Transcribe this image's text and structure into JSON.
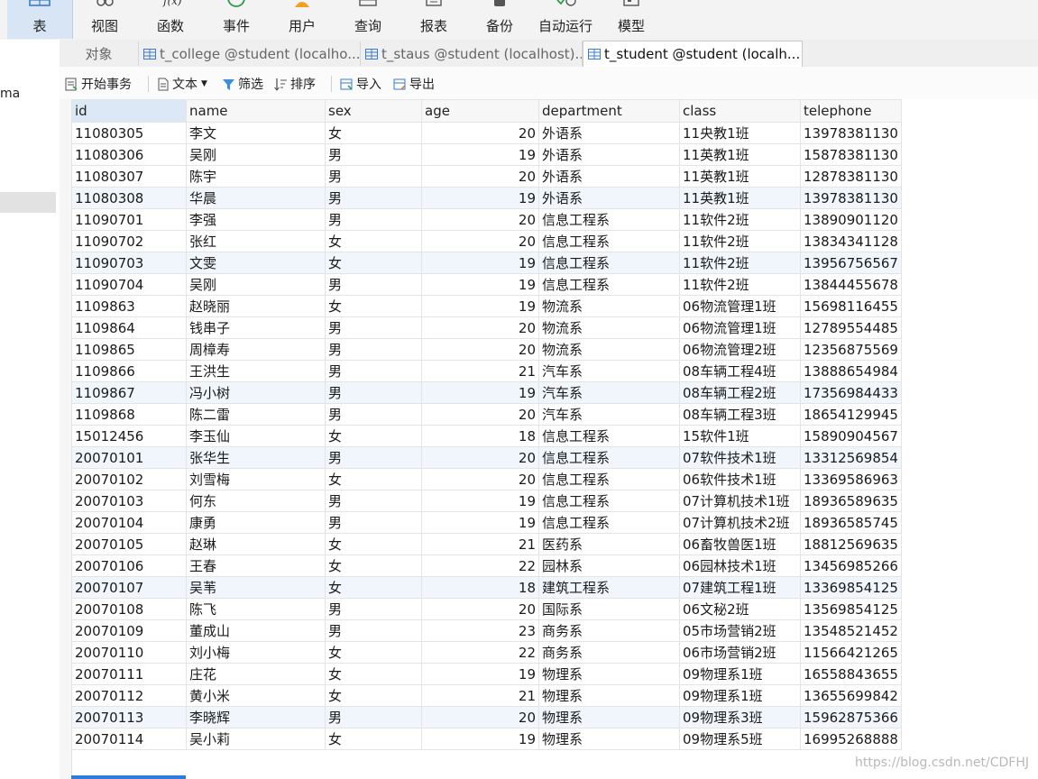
{
  "ribbon": {
    "items": [
      {
        "label": "表",
        "icon": "table-icon",
        "active": true
      },
      {
        "label": "视图",
        "icon": "view-icon"
      },
      {
        "label": "函数",
        "icon": "function-icon"
      },
      {
        "label": "事件",
        "icon": "event-clock-icon"
      },
      {
        "label": "用户",
        "icon": "user-icon"
      },
      {
        "label": "查询",
        "icon": "query-icon"
      },
      {
        "label": "报表",
        "icon": "report-icon"
      },
      {
        "label": "备份",
        "icon": "backup-icon"
      },
      {
        "label": "自动运行",
        "icon": "auto-run-icon"
      },
      {
        "label": "模型",
        "icon": "model-icon"
      }
    ]
  },
  "left_panel": {
    "schema_fragment": "ma"
  },
  "tabs": {
    "objects": "对象",
    "items": [
      {
        "label": "t_college @student (localho..."
      },
      {
        "label": "t_staus @student (localhost)..."
      },
      {
        "label": "t_student @student (localh...",
        "active": true
      }
    ]
  },
  "toolbar": {
    "begin_transaction": "开始事务",
    "text": "文本",
    "filter": "筛选",
    "sort": "排序",
    "import": "导入",
    "export": "导出"
  },
  "table": {
    "columns": [
      "id",
      "name",
      "sex",
      "age",
      "department",
      "class",
      "telephone"
    ],
    "rows": [
      [
        "11080305",
        "李文",
        "女",
        "20",
        "外语系",
        "11央教1班",
        "13978381130"
      ],
      [
        "11080306",
        "吴刚",
        "男",
        "19",
        "外语系",
        "11英教1班",
        "15878381130"
      ],
      [
        "11080307",
        "陈宇",
        "男",
        "20",
        "外语系",
        "11英教1班",
        "12878381130"
      ],
      [
        "11080308",
        "华晨",
        "男",
        "19",
        "外语系",
        "11英教1班",
        "13978381130"
      ],
      [
        "11090701",
        "李强",
        "男",
        "20",
        "信息工程系",
        "11软件2班",
        "13890901120"
      ],
      [
        "11090702",
        "张红",
        "女",
        "20",
        "信息工程系",
        "11软件2班",
        "13834341128"
      ],
      [
        "11090703",
        "文雯",
        "女",
        "19",
        "信息工程系",
        "11软件2班",
        "13956756567"
      ],
      [
        "11090704",
        "吴刚",
        "男",
        "19",
        "信息工程系",
        "11软件2班",
        "13844455678"
      ],
      [
        "1109863",
        "赵晓丽",
        "女",
        "19",
        "物流系",
        "06物流管理1班",
        "15698116455"
      ],
      [
        "1109864",
        "钱串子",
        "男",
        "20",
        "物流系",
        "06物流管理1班",
        "12789554485"
      ],
      [
        "1109865",
        "周樟寿",
        "男",
        "20",
        "物流系",
        "06物流管理2班",
        "12356875569"
      ],
      [
        "1109866",
        "王洪生",
        "男",
        "21",
        "汽车系",
        "08车辆工程4班",
        "13888654984"
      ],
      [
        "1109867",
        "冯小树",
        "男",
        "19",
        "汽车系",
        "08车辆工程2班",
        "17356984433"
      ],
      [
        "1109868",
        "陈二雷",
        "男",
        "20",
        "汽车系",
        "08车辆工程3班",
        "18654129945"
      ],
      [
        "15012456",
        "李玉仙",
        "女",
        "18",
        "信息工程系",
        "15软件1班",
        "15890904567"
      ],
      [
        "20070101",
        "张华生",
        "男",
        "20",
        "信息工程系",
        "07软件技术1班",
        "13312569854"
      ],
      [
        "20070102",
        "刘雪梅",
        "女",
        "20",
        "信息工程系",
        "06软件技术1班",
        "13369586963"
      ],
      [
        "20070103",
        "何东",
        "男",
        "19",
        "信息工程系",
        "07计算机技术1班",
        "18936589635"
      ],
      [
        "20070104",
        "康勇",
        "男",
        "19",
        "信息工程系",
        "07计算机技术2班",
        "18936585745"
      ],
      [
        "20070105",
        "赵琳",
        "女",
        "21",
        "医药系",
        "06畜牧兽医1班",
        "18812569635"
      ],
      [
        "20070106",
        "王春",
        "女",
        "22",
        "园林系",
        "06园林技术1班",
        "13456985266"
      ],
      [
        "20070107",
        "吴苇",
        "女",
        "18",
        "建筑工程系",
        "07建筑工程1班",
        "13369854125"
      ],
      [
        "20070108",
        "陈飞",
        "男",
        "20",
        "国际系",
        "06文秘2班",
        "13569854125"
      ],
      [
        "20070109",
        "董成山",
        "男",
        "23",
        "商务系",
        "05市场营销2班",
        "13548521452"
      ],
      [
        "20070110",
        "刘小梅",
        "女",
        "22",
        "商务系",
        "06市场营销2班",
        "11566421265"
      ],
      [
        "20070111",
        "庄花",
        "女",
        "19",
        "物理系",
        "09物理系1班",
        "16558843655"
      ],
      [
        "20070112",
        "黄小米",
        "女",
        "21",
        "物理系",
        "09物理系1班",
        "13655699842"
      ],
      [
        "20070113",
        "李晓辉",
        "男",
        "20",
        "物理系",
        "09物理系3班",
        "15962875366"
      ],
      [
        "20070114",
        "吴小莉",
        "女",
        "19",
        "物理系",
        "09物理系5班",
        "16995268888"
      ]
    ]
  },
  "watermark": "https://blog.csdn.net/CDFHJ",
  "colors": {
    "accent": "#2f7bd8",
    "alt_row": "#f1f6fc",
    "selected_header": "#dce8f6"
  }
}
